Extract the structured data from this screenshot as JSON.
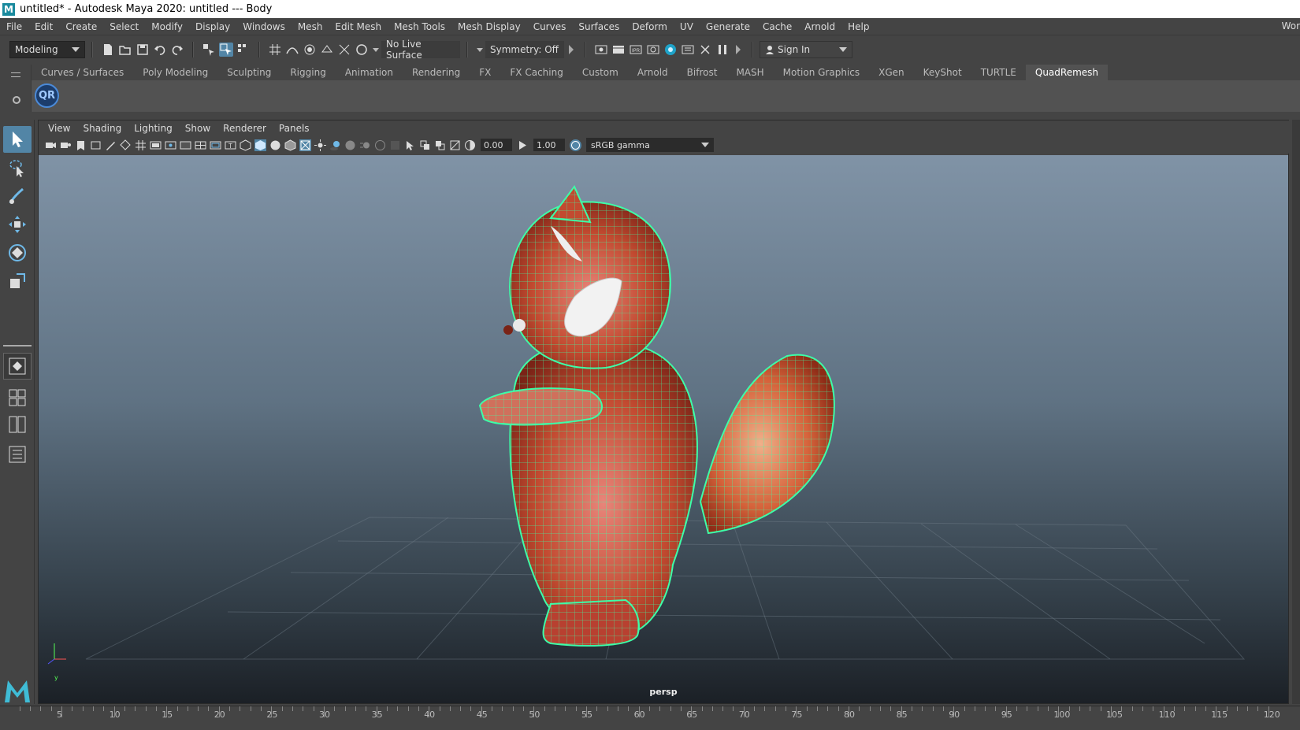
{
  "window": {
    "title": "untitled* - Autodesk Maya 2020: untitled   ---   Body"
  },
  "menu": {
    "items": [
      "File",
      "Edit",
      "Create",
      "Select",
      "Modify",
      "Display",
      "Windows",
      "Mesh",
      "Edit Mesh",
      "Mesh Tools",
      "Mesh Display",
      "Curves",
      "Surfaces",
      "Deform",
      "UV",
      "Generate",
      "Cache",
      "Arnold",
      "Help"
    ],
    "right_text": "Wor"
  },
  "status_line": {
    "mode": "Modeling",
    "live_surface": "No Live Surface",
    "symmetry": "Symmetry: Off",
    "sign_in": "Sign In"
  },
  "shelf": {
    "tabs": [
      "Curves / Surfaces",
      "Poly Modeling",
      "Sculpting",
      "Rigging",
      "Animation",
      "Rendering",
      "FX",
      "FX Caching",
      "Custom",
      "Arnold",
      "Bifrost",
      "MASH",
      "Motion Graphics",
      "XGen",
      "KeyShot",
      "TURTLE",
      "QuadRemesh"
    ],
    "active_tab": "QuadRemesh",
    "qr_label": "QR"
  },
  "panel": {
    "menus": [
      "View",
      "Shading",
      "Lighting",
      "Show",
      "Renderer",
      "Panels"
    ],
    "exposure": "0.00",
    "gamma": "1.00",
    "color_space": "sRGB gamma",
    "camera": "persp",
    "axis_label": "y"
  },
  "timeline": {
    "labels": [
      "5",
      "10",
      "15",
      "20",
      "25",
      "30",
      "35",
      "40",
      "45",
      "50",
      "55",
      "60",
      "65",
      "70",
      "75",
      "80",
      "85",
      "90",
      "95",
      "100",
      "105",
      "110",
      "115",
      "120"
    ]
  },
  "colors": {
    "accent": "#5285a6",
    "wireframe": "#3dffa8",
    "model": "#c0432a"
  }
}
